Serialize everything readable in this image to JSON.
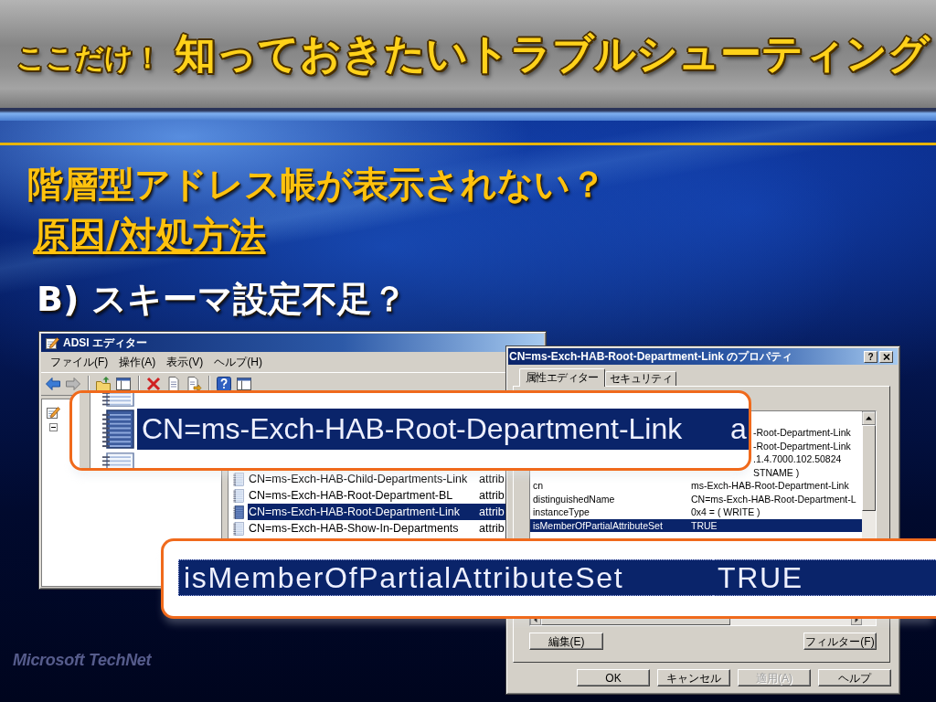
{
  "header": {
    "title_prefix": "ここだけ！",
    "title": "知っておきたいトラブルシューティング"
  },
  "slide": {
    "heading": "階層型アドレス帳が表示されない？",
    "subheading": "原因/対処方法",
    "point": "B) スキーマ設定不足？"
  },
  "adsi_window": {
    "title": "ADSI エディター",
    "menu": [
      "ファイル(F)",
      "操作(A)",
      "表示(V)",
      "ヘルプ(H)"
    ],
    "tree_node": {
      "expanded": true
    },
    "list_rows": [
      {
        "name": "CN=ms-Exch-HAB-Child-Departments-Link",
        "type": "attrib",
        "selected": false
      },
      {
        "name": "CN=ms-Exch-HAB-Root-Department-BL",
        "type": "attrib",
        "selected": false
      },
      {
        "name": "CN=ms-Exch-HAB-Root-Department-Link",
        "type": "attrib",
        "selected": true
      },
      {
        "name": "CN=ms-Exch-HAB-Show-In-Departments",
        "type": "attrib",
        "selected": false
      }
    ]
  },
  "properties_dialog": {
    "title": "CN=ms-Exch-HAB-Root-Department-Link のプロパティ",
    "help_button": "?",
    "tabs": [
      {
        "label": "属性エディター",
        "selected": true
      },
      {
        "label": "セキュリティ",
        "selected": false
      }
    ],
    "attributes": [
      {
        "kind": "covered",
        "value": "-Root-Department-Link",
        "selected": false
      },
      {
        "kind": "covered",
        "value": "-Root-Department-Link",
        "selected": false
      },
      {
        "kind": "covered",
        "value": ".1.4.7000.102.50824",
        "selected": false
      },
      {
        "kind": "covered",
        "value": "STNAME )",
        "selected": false
      },
      {
        "kind": "plain",
        "name": "cn",
        "value": "ms-Exch-HAB-Root-Department-Link",
        "selected": false
      },
      {
        "kind": "plain",
        "name": "distinguishedName",
        "value": "CN=ms-Exch-HAB-Root-Department-L",
        "selected": false
      },
      {
        "kind": "plain",
        "name": "instanceType",
        "value": "0x4 = ( WRITE )",
        "selected": false
      },
      {
        "kind": "plain",
        "name": "isMemberOfPartialAttributeSet",
        "value": "TRUE",
        "selected": true
      }
    ],
    "edit_button": "編集(E)",
    "filter_button": "フィルター(F)",
    "buttons": [
      {
        "label": "OK",
        "disabled": false
      },
      {
        "label": "キャンセル",
        "disabled": false
      },
      {
        "label": "適用(A)",
        "disabled": true
      },
      {
        "label": "ヘルプ",
        "disabled": false
      }
    ]
  },
  "callouts": [
    {
      "rows": [
        {
          "name": "CN=ms-Exch-HAB-Root-Department-Link",
          "column_2": "a",
          "selected": true
        }
      ]
    },
    {
      "rows": [
        {
          "name": "isMemberOfPartialAttributeSet",
          "value": "TRUE",
          "selected": true
        }
      ]
    }
  ],
  "logo": "Microsoft TechNet"
}
